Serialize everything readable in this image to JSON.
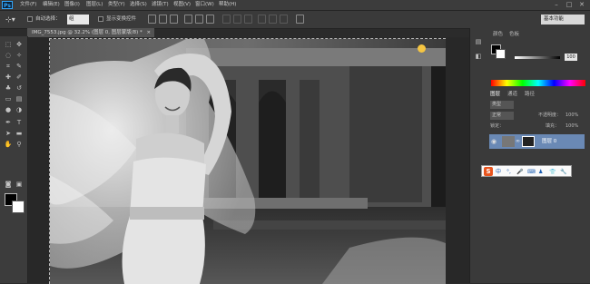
{
  "app": {
    "logo": "Ps"
  },
  "menubar": {
    "items": [
      {
        "label": "文件(F)"
      },
      {
        "label": "编辑(E)"
      },
      {
        "label": "图像(I)"
      },
      {
        "label": "图层(L)"
      },
      {
        "label": "类型(Y)"
      },
      {
        "label": "选择(S)"
      },
      {
        "label": "滤镜(T)"
      },
      {
        "label": "视图(V)"
      },
      {
        "label": "窗口(W)"
      },
      {
        "label": "帮助(H)"
      }
    ],
    "window_controls": {
      "minimize": "–",
      "maximize": "□",
      "close": "✕"
    }
  },
  "options": {
    "auto_select_label": "自动选择：",
    "auto_select_value": "组",
    "show_transform_label": "显示变换控件",
    "workspace": "基本功能"
  },
  "document": {
    "tab_title": "IMG_7553.jpg @ 32.2% (图层 0, 图层蒙版/8) *",
    "close": "×"
  },
  "panels": {
    "color_tabs": [
      "颜色",
      "色板"
    ],
    "color_value": "100",
    "layers_tabs": [
      "图层",
      "通道",
      "路径"
    ],
    "kind_filter": "类型",
    "blend_mode": "正常",
    "opacity_label": "不透明度：",
    "opacity_value": "100%",
    "lock_label": "锁定：",
    "fill_label": "填充：",
    "fill_value": "100%",
    "layer_name": "图层 0"
  },
  "ime": {
    "logo": "S",
    "mode": "中"
  },
  "icons": {
    "move": "move-tool-icon",
    "marquee": "marquee-tool-icon",
    "lasso": "lasso-tool-icon"
  }
}
